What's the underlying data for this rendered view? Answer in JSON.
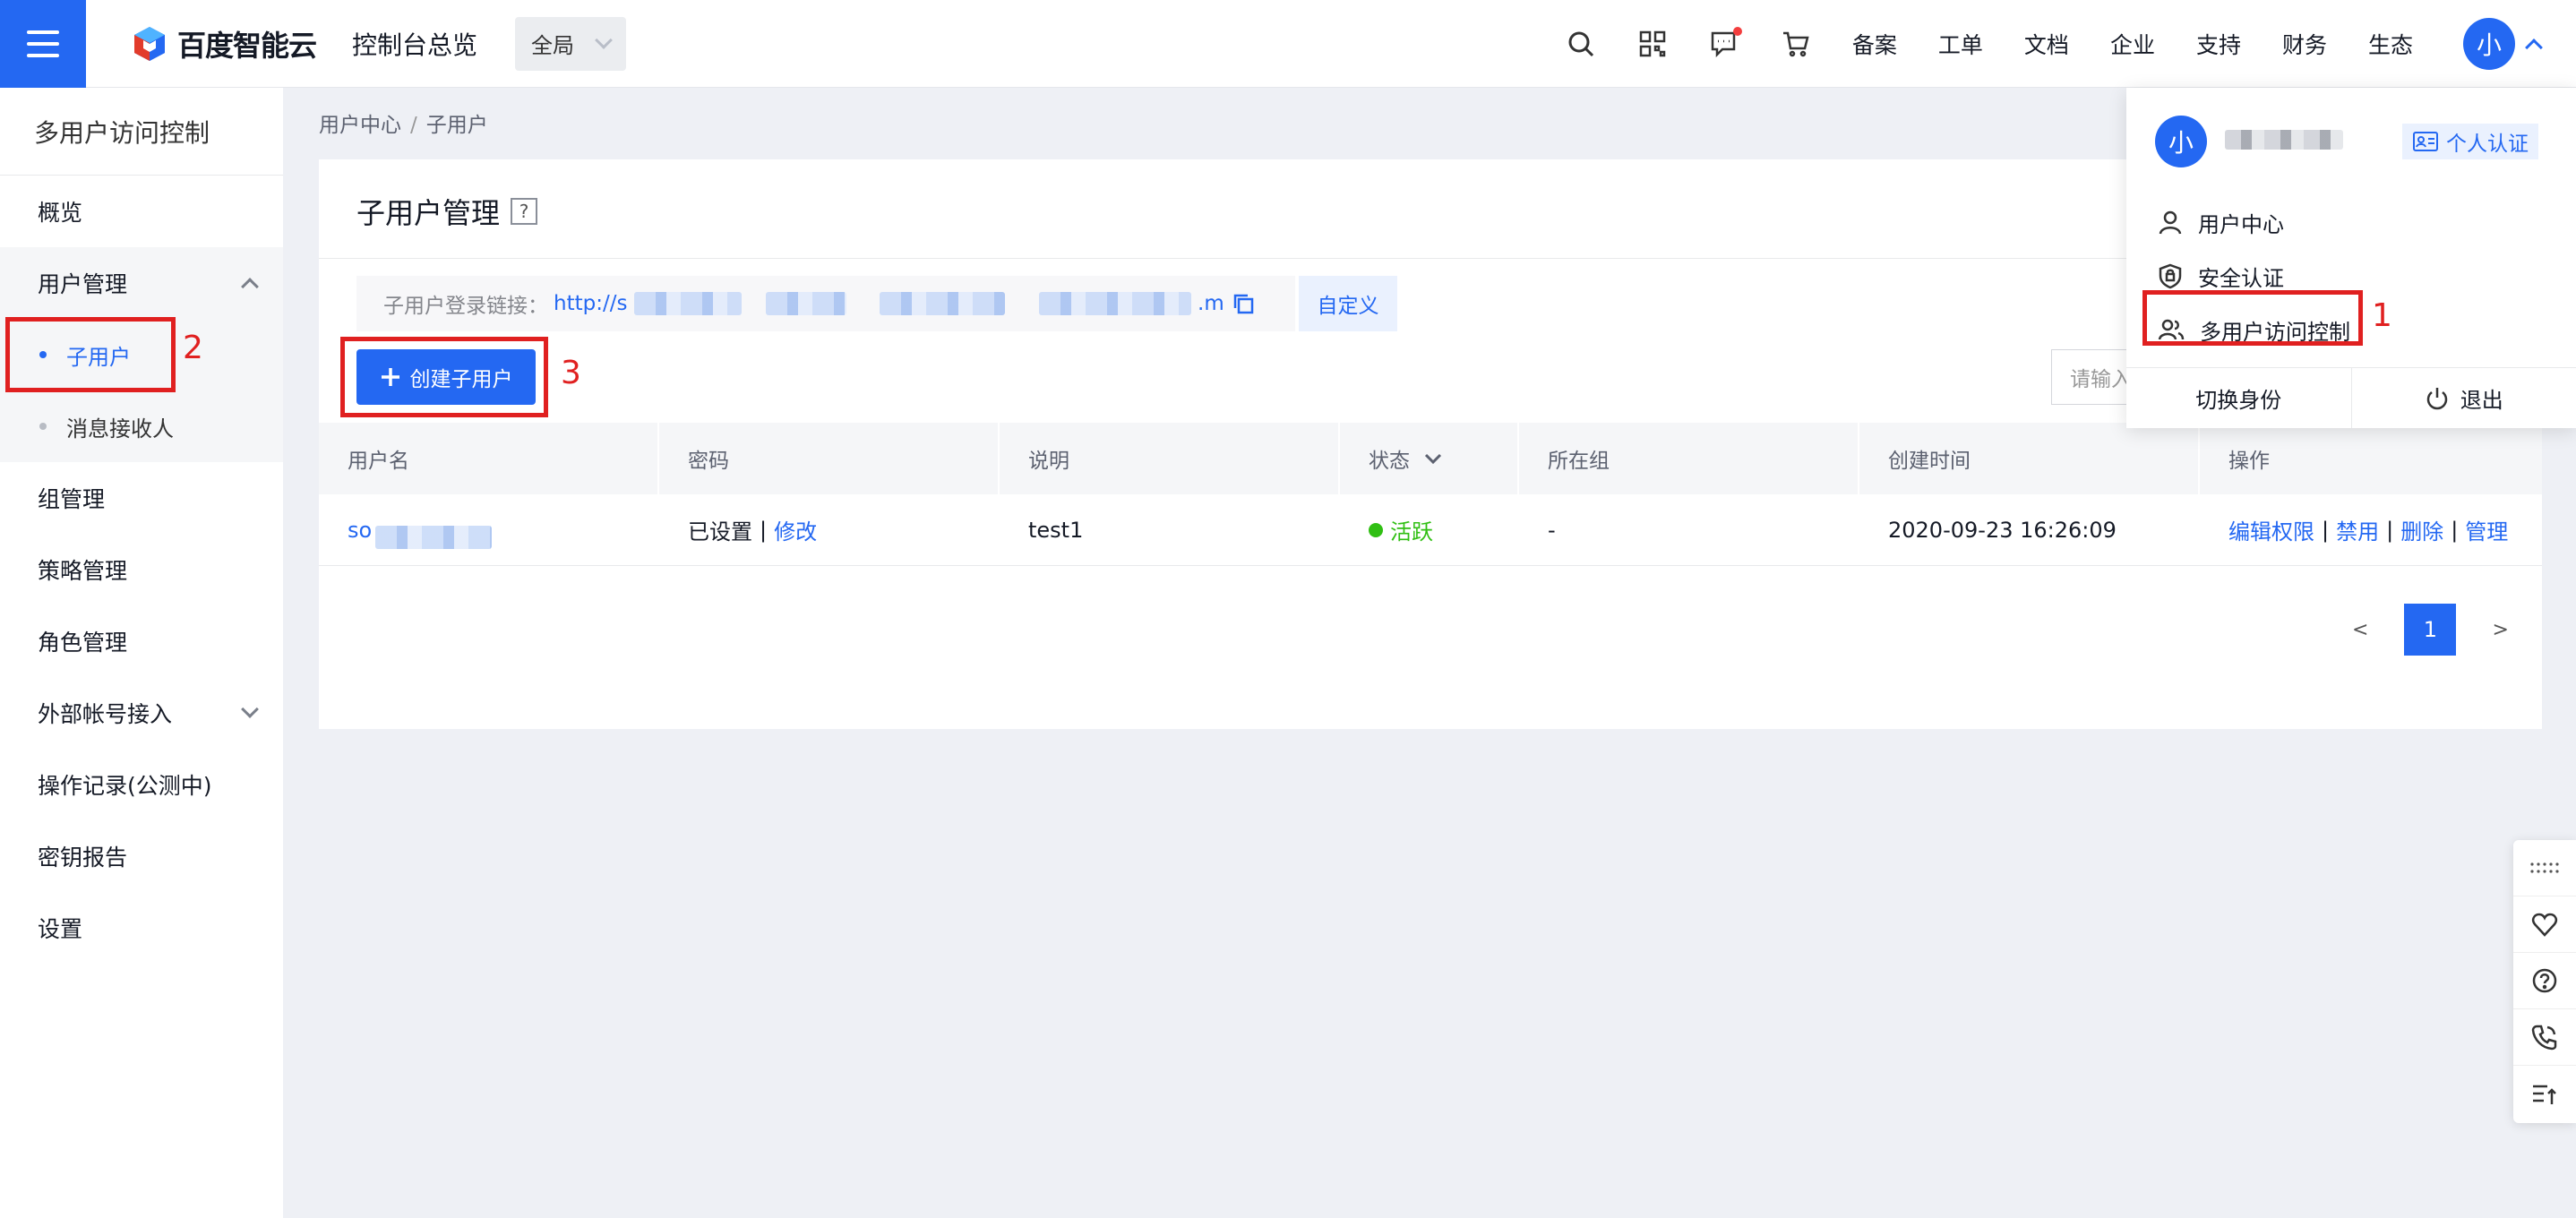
{
  "topbar": {
    "logo_text": "百度智能云",
    "console_overview": "控制台总览",
    "region": "全局",
    "nav": [
      "备案",
      "工单",
      "文档",
      "企业",
      "支持",
      "财务",
      "生态"
    ],
    "avatar_letter": "小",
    "accent": "#2468f2"
  },
  "sidebar": {
    "title": "多用户访问控制",
    "items": {
      "overview": "概览",
      "user_mgmt": "用户管理",
      "sub_user": "子用户",
      "msg_receiver": "消息接收人",
      "group_mgmt": "组管理",
      "policy_mgmt": "策略管理",
      "role_mgmt": "角色管理",
      "external": "外部帐号接入",
      "op_log": "操作记录(公测中)",
      "key_report": "密钥报告",
      "settings": "设置"
    }
  },
  "breadcrumb": {
    "root": "用户中心",
    "sep": "/",
    "current": "子用户"
  },
  "main": {
    "title": "子用户管理",
    "help": "?",
    "login_link_label": "子用户登录链接：",
    "login_link_prefix": "http://s",
    "login_link_suffix": ".m",
    "customize": "自定义",
    "create_button": "创建子用户",
    "search_placeholder": "请输入",
    "columns": [
      "用户名",
      "密码",
      "说明",
      "状态",
      "所在组",
      "创建时间",
      "操作"
    ],
    "row": {
      "username": "so",
      "password_set": "已设置",
      "password_edit": "修改",
      "desc": "test1",
      "status": "活跃",
      "group": "-",
      "created": "2020-09-23 16:26:09",
      "actions": [
        "编辑权限",
        "禁用",
        "删除",
        "管理"
      ],
      "pipe": "|"
    },
    "pager": {
      "prev": "<",
      "page": "1",
      "next": ">"
    }
  },
  "dropdown": {
    "avatar_letter": "小",
    "verify": "个人认证",
    "items": [
      "用户中心",
      "安全认证",
      "多用户访问控制"
    ],
    "switch_identity": "切换身份",
    "logout": "退出"
  },
  "annotations": {
    "a1": "1",
    "a2": "2",
    "a3": "3",
    "color": "#e02020"
  }
}
